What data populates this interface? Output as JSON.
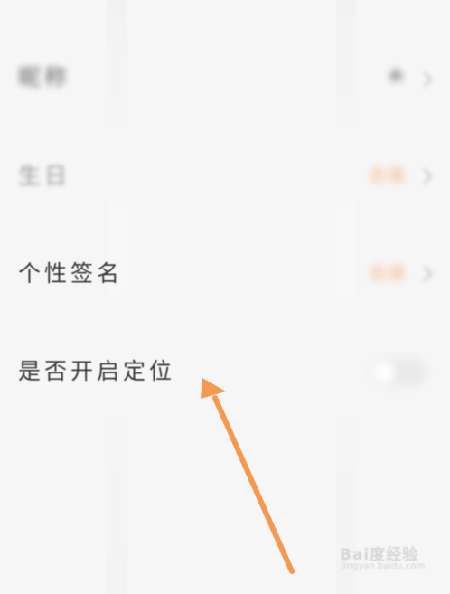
{
  "settings": {
    "rows": [
      {
        "label": "昵称",
        "value": ""
      },
      {
        "label": "生日",
        "value": "去填"
      },
      {
        "label": "个性签名",
        "value": "去填"
      },
      {
        "label": "是否开启定位",
        "toggle": false
      }
    ]
  },
  "annotation": {
    "arrow_color": "#f39a50"
  },
  "watermark": {
    "logo_text": "Bai度经验",
    "url_text": "jingyan.baidu.com"
  },
  "colors": {
    "background": "#f6f6f6",
    "label": "#3b3b3b",
    "accent_value": "#f7b98a"
  }
}
